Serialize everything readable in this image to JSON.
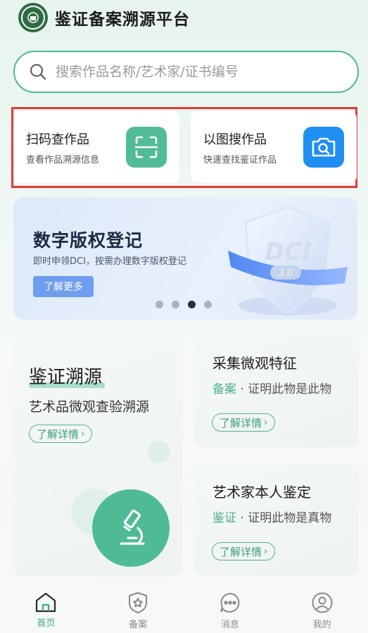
{
  "header": {
    "title": "鉴证备案溯源平台"
  },
  "search": {
    "placeholder": "搜索作品名称/艺术家/证书编号"
  },
  "quick_actions": [
    {
      "title": "扫码查作品",
      "subtitle": "查看作品溯源信息",
      "icon": "scan-icon",
      "color": "#52bc97"
    },
    {
      "title": "以图搜作品",
      "subtitle": "快速查找鉴证作品",
      "icon": "camera-icon",
      "color": "#1f8ef1"
    }
  ],
  "banner": {
    "title": "数字版权登记",
    "subtitle": "即时申领DCI，按需办理数字版权登记",
    "button": "了解更多",
    "badge_text": "DCI",
    "badge_version": "3.0",
    "slide_count": 4,
    "active_slide": 3
  },
  "cards": {
    "main": {
      "title": "鉴证溯源",
      "subtitle": "艺术品微观查验溯源",
      "button": "了解详情",
      "icon": "microscope-icon"
    },
    "collect": {
      "title": "采集微观特征",
      "accent": "备案",
      "desc": " · 证明此物是此物",
      "button": "了解详情"
    },
    "artist": {
      "title": "艺术家本人鉴定",
      "accent": "鉴证",
      "desc": " · 证明此物是真物",
      "button": "了解详情"
    }
  },
  "nav": [
    {
      "label": "首页",
      "icon": "home-icon",
      "active": true
    },
    {
      "label": "备案",
      "icon": "shield-star-icon",
      "active": false
    },
    {
      "label": "消息",
      "icon": "message-icon",
      "active": false
    },
    {
      "label": "我的",
      "icon": "user-icon",
      "active": false
    }
  ],
  "colors": {
    "accent": "#4eb893",
    "highlight": "#e53935",
    "blue": "#1f8ef1"
  }
}
